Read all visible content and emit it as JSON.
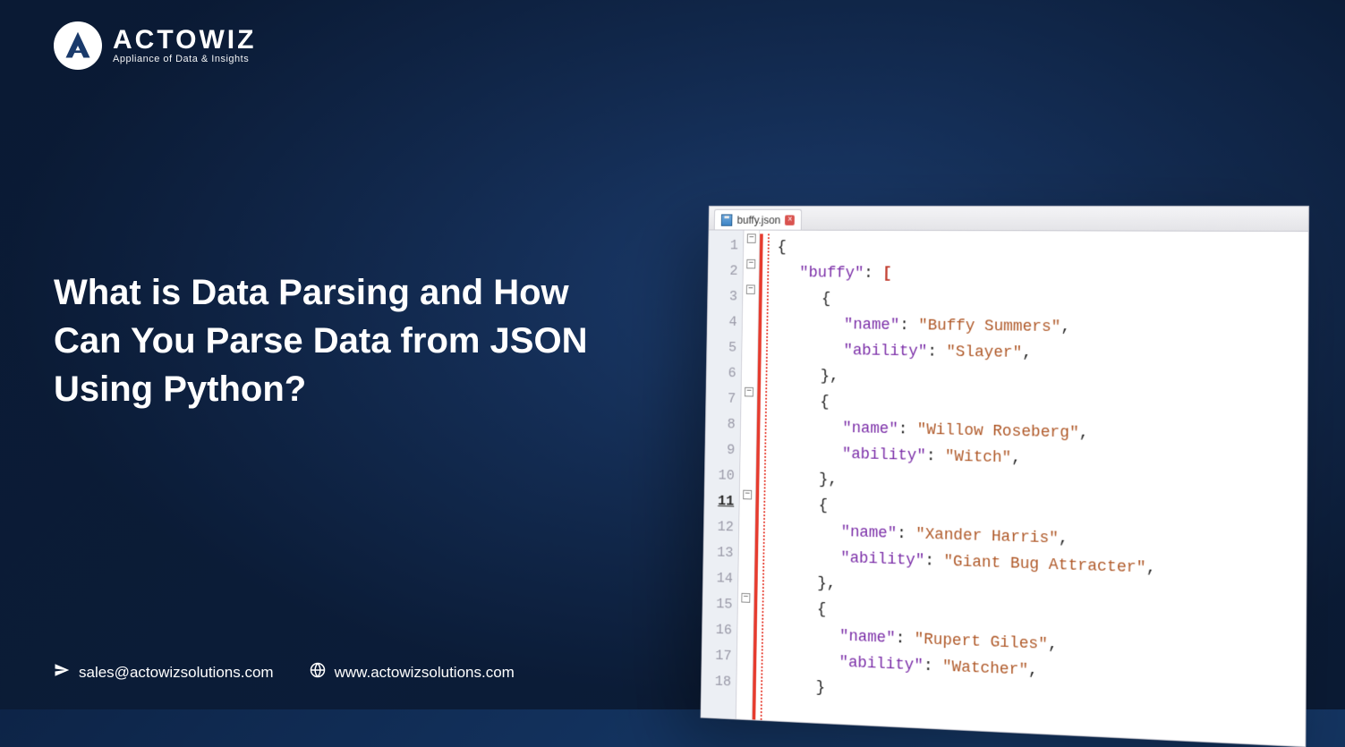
{
  "logo": {
    "brand": "ACTOWIZ",
    "tagline": "Appliance of Data & Insights"
  },
  "headline": "What is Data Parsing and How Can You Parse Data from JSON Using Python?",
  "footer": {
    "email": "sales@actowizsolutions.com",
    "website": "www.actowizsolutions.com"
  },
  "editor": {
    "tab_filename": "buffy.json",
    "line_count": 18,
    "highlighted_line": 11,
    "code_lines": [
      {
        "indent": 0,
        "tokens": [
          {
            "t": "brace",
            "v": "{"
          }
        ]
      },
      {
        "indent": 1,
        "tokens": [
          {
            "t": "key",
            "v": "\"buffy\""
          },
          {
            "t": "punc",
            "v": ": "
          },
          {
            "t": "bracket",
            "v": "["
          }
        ]
      },
      {
        "indent": 2,
        "tokens": [
          {
            "t": "brace",
            "v": "{"
          }
        ]
      },
      {
        "indent": 3,
        "tokens": [
          {
            "t": "key",
            "v": "\"name\""
          },
          {
            "t": "punc",
            "v": ": "
          },
          {
            "t": "str",
            "v": "\"Buffy Summers\""
          },
          {
            "t": "punc",
            "v": ","
          }
        ]
      },
      {
        "indent": 3,
        "tokens": [
          {
            "t": "key",
            "v": "\"ability\""
          },
          {
            "t": "punc",
            "v": ": "
          },
          {
            "t": "str",
            "v": "\"Slayer\""
          },
          {
            "t": "punc",
            "v": ","
          }
        ]
      },
      {
        "indent": 2,
        "tokens": [
          {
            "t": "brace",
            "v": "},"
          }
        ]
      },
      {
        "indent": 2,
        "tokens": [
          {
            "t": "brace",
            "v": "{"
          }
        ]
      },
      {
        "indent": 3,
        "tokens": [
          {
            "t": "key",
            "v": "\"name\""
          },
          {
            "t": "punc",
            "v": ": "
          },
          {
            "t": "str",
            "v": "\"Willow Roseberg\""
          },
          {
            "t": "punc",
            "v": ","
          }
        ]
      },
      {
        "indent": 3,
        "tokens": [
          {
            "t": "key",
            "v": "\"ability\""
          },
          {
            "t": "punc",
            "v": ": "
          },
          {
            "t": "str",
            "v": "\"Witch\""
          },
          {
            "t": "punc",
            "v": ","
          }
        ]
      },
      {
        "indent": 2,
        "tokens": [
          {
            "t": "brace",
            "v": "},"
          }
        ]
      },
      {
        "indent": 2,
        "tokens": [
          {
            "t": "brace",
            "v": "{"
          }
        ]
      },
      {
        "indent": 3,
        "tokens": [
          {
            "t": "key",
            "v": "\"name\""
          },
          {
            "t": "punc",
            "v": ": "
          },
          {
            "t": "str",
            "v": "\"Xander Harris\""
          },
          {
            "t": "punc",
            "v": ","
          }
        ]
      },
      {
        "indent": 3,
        "tokens": [
          {
            "t": "key",
            "v": "\"ability\""
          },
          {
            "t": "punc",
            "v": ": "
          },
          {
            "t": "str",
            "v": "\"Giant Bug Attracter\""
          },
          {
            "t": "punc",
            "v": ","
          }
        ]
      },
      {
        "indent": 2,
        "tokens": [
          {
            "t": "brace",
            "v": "},"
          }
        ]
      },
      {
        "indent": 2,
        "tokens": [
          {
            "t": "brace",
            "v": "{"
          }
        ]
      },
      {
        "indent": 3,
        "tokens": [
          {
            "t": "key",
            "v": "\"name\""
          },
          {
            "t": "punc",
            "v": ": "
          },
          {
            "t": "str",
            "v": "\"Rupert Giles\""
          },
          {
            "t": "punc",
            "v": ","
          }
        ]
      },
      {
        "indent": 3,
        "tokens": [
          {
            "t": "key",
            "v": "\"ability\""
          },
          {
            "t": "punc",
            "v": ": "
          },
          {
            "t": "str",
            "v": "\"Watcher\""
          },
          {
            "t": "punc",
            "v": ","
          }
        ]
      },
      {
        "indent": 2,
        "tokens": [
          {
            "t": "brace",
            "v": "}"
          }
        ]
      }
    ],
    "fold_markers": [
      1,
      2,
      3,
      7,
      11,
      15
    ]
  }
}
